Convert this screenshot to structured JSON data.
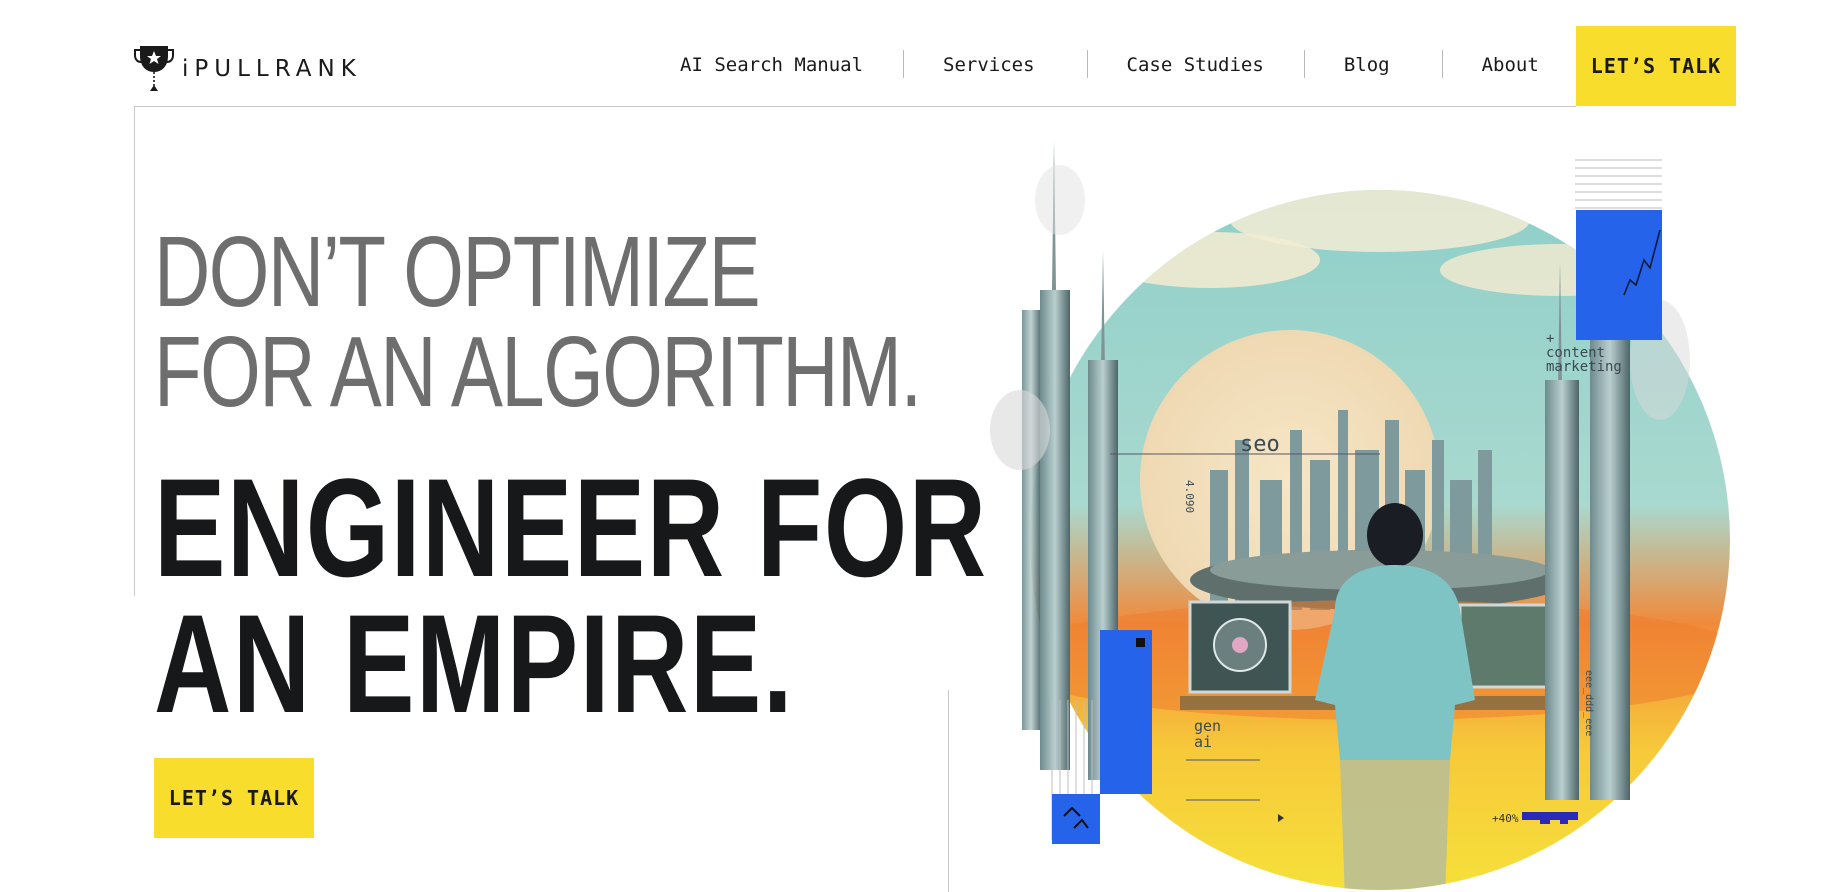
{
  "header": {
    "logo_text": "iPULLRANK",
    "nav": [
      {
        "label": "AI Search Manual"
      },
      {
        "label": "Services"
      },
      {
        "label": "Case Studies"
      },
      {
        "label": "Blog"
      },
      {
        "label": "About"
      }
    ],
    "cta_label": "LET’S TALK"
  },
  "hero": {
    "headline_light": [
      "DON’T OPTIMIZE",
      "FOR AN ALGORITHM."
    ],
    "headline_bold": [
      "ENGINEER FOR",
      "AN EMPIRE."
    ],
    "cta_label": "LET’S TALK"
  },
  "illustration": {
    "labels": {
      "content_marketing": "+\ncontent\nmarketing",
      "seo": "seo",
      "gen_ai": "gen\nai",
      "percent": "+40%",
      "vertical_left": "4.090",
      "vertical_right": "eee_ddd_eee"
    }
  },
  "colors": {
    "accent_yellow": "#f9dd2c",
    "accent_blue": "#2563eb",
    "text_dark": "#161819",
    "text_light": "#6e6e6e"
  }
}
